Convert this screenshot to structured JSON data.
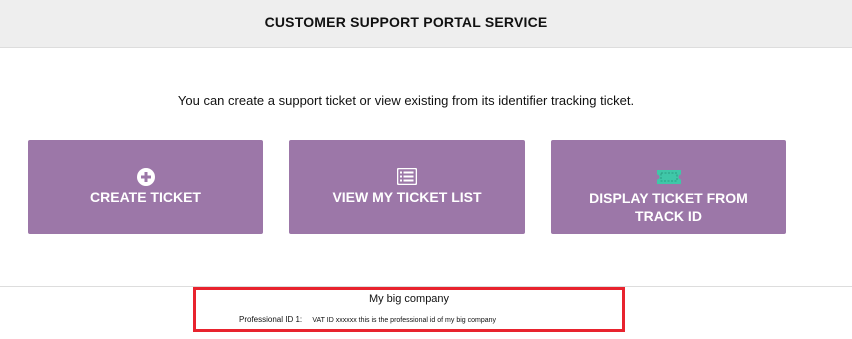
{
  "header": {
    "title": "CUSTOMER SUPPORT PORTAL SERVICE"
  },
  "intro": {
    "text": "You can create a support ticket or view existing from its identifier tracking ticket."
  },
  "actions": {
    "create_ticket": {
      "label": "CREATE TICKET",
      "icon": "plus-circle-icon"
    },
    "view_ticket_list": {
      "label": "VIEW MY TICKET LIST",
      "icon": "list-icon"
    },
    "display_ticket": {
      "label": "DISPLAY TICKET FROM TRACK ID",
      "icon": "ticket-icon"
    }
  },
  "footer": {
    "company_name": "My big company",
    "professional_id_label": "Professional ID 1:",
    "professional_id_value": "VAT ID xxxxxx this is the professional id of my big company"
  },
  "colors": {
    "header_bg": "#eeeeee",
    "button_bg": "#9c77a8",
    "ticket_icon": "#3fc7a8",
    "highlight_border": "#e8232e"
  }
}
